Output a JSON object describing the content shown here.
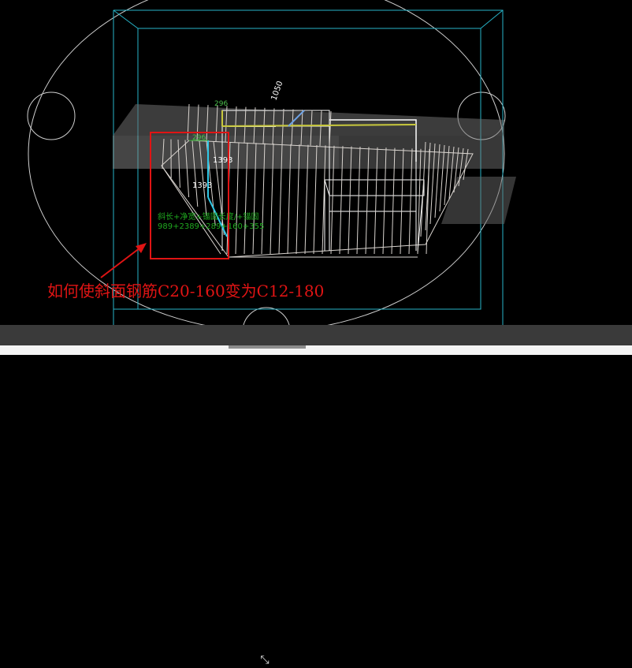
{
  "viewport": {
    "labels": {
      "top_dim": "296",
      "inner_dim": "296",
      "height_dim_1": "1393",
      "height_dim_2": "1393",
      "formula_line_1": "斜长+净宽+锚固长度/+锚固",
      "formula_line_2": "989+2389+289+160+355",
      "tilted_text": "1050"
    },
    "annotation": {
      "question": "如何使斜面钢筋C20-160变为C12-180"
    }
  },
  "colors": {
    "background": "#000000",
    "bounding_box": "#27b3c7",
    "rebar": "#d9d4cf",
    "highlight_rect": "#e01414",
    "annotation_text": "#e01414",
    "dim_yellow": "#c8c83c",
    "dim_blue": "#6fa3e6",
    "dim_cyan": "#2fc7e6",
    "status_bar": "#3a3a3a"
  },
  "statusbar": {
    "zoom_icon": "shrink-arrows-icon"
  }
}
